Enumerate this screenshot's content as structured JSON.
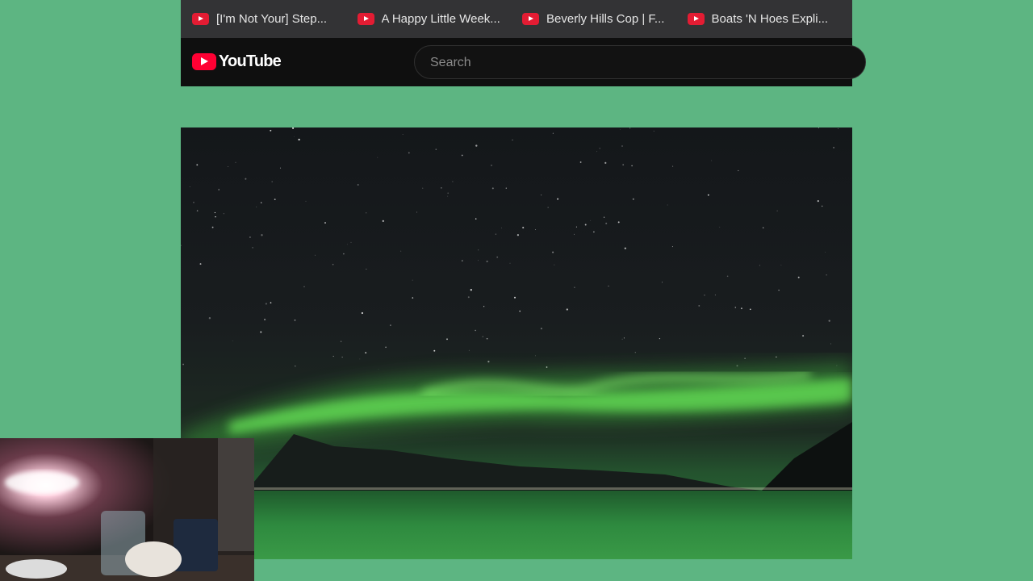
{
  "browser": {
    "tabs": [
      {
        "title": "[I'm Not Your] Step..."
      },
      {
        "title": "A Happy Little Week..."
      },
      {
        "title": "Beverly Hills Cop | F..."
      },
      {
        "title": "Boats 'N Hoes Expli..."
      }
    ]
  },
  "youtube": {
    "logo_text": "YouTube",
    "search_placeholder": "Search"
  },
  "colors": {
    "background": "#5db582",
    "tabbar": "#333335",
    "header": "#0f0f0f",
    "youtube_red": "#ff0033",
    "aurora_green": "#6cef5a"
  }
}
